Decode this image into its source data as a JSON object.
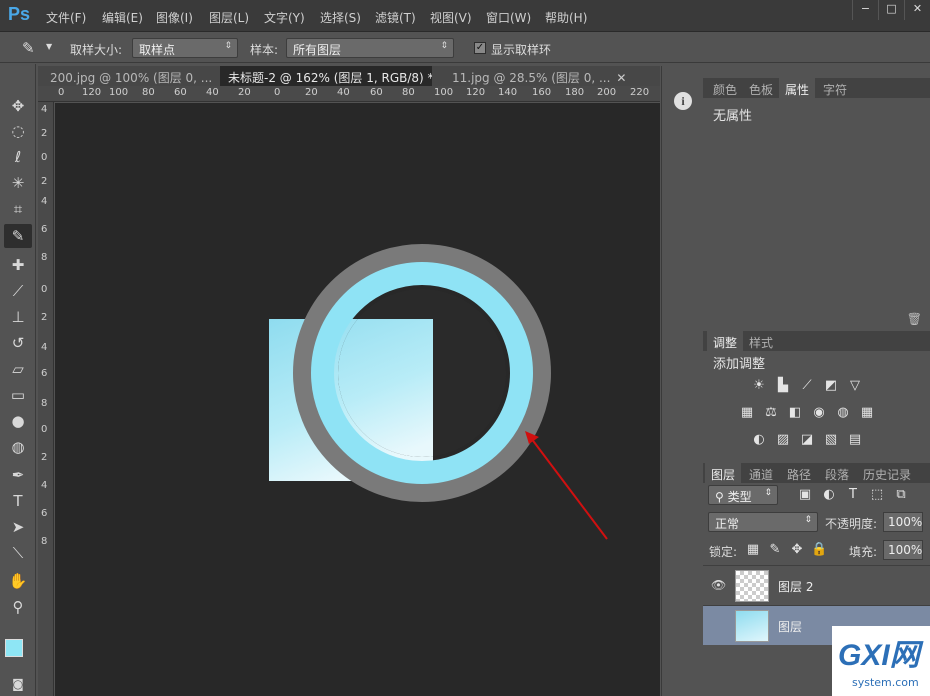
{
  "app": {
    "logo": "Ps"
  },
  "menu": [
    "文件(F)",
    "编辑(E)",
    "图像(I)",
    "图层(L)",
    "文字(Y)",
    "选择(S)",
    "滤镜(T)",
    "视图(V)",
    "窗口(W)",
    "帮助(H)"
  ],
  "window_buttons": [
    "−",
    "□",
    "✕"
  ],
  "options": {
    "sample_size_label": "取样大小:",
    "sample_size_value": "取样点",
    "sample_label": "样本:",
    "sample_value": "所有图层",
    "show_ring_label": "显示取样环",
    "show_ring_checked": "✓"
  },
  "tabs": [
    {
      "label": "200.jpg @ 100% (图层 0, ...",
      "close": "✕"
    },
    {
      "label": "未标题-2 @ 162% (图层 1, RGB/8) *",
      "close": "✕"
    },
    {
      "label": "11.jpg @ 28.5% (图层 0, ...",
      "close": "✕"
    }
  ],
  "ruler_h": [
    "0",
    "120",
    "100",
    "80",
    "60",
    "40",
    "20",
    "0",
    "20",
    "40",
    "60",
    "80",
    "100",
    "120",
    "140",
    "160",
    "180",
    "200",
    "220"
  ],
  "ruler_v": [
    "4",
    "2",
    "0",
    "2",
    "4",
    "6",
    "8",
    "0",
    "2",
    "4",
    "6",
    "8",
    "0",
    "2",
    "4",
    "6",
    "8"
  ],
  "properties": {
    "tabs": [
      "颜色",
      "色板",
      "属性",
      "字符"
    ],
    "content": "无属性"
  },
  "adjustments": {
    "tabs": [
      "调整",
      "样式"
    ],
    "title": "添加调整",
    "icons": [
      "brightness-icon",
      "levels-icon",
      "curves-icon",
      "exposure-icon",
      "vibrance-icon",
      "hue-icon",
      "balance-icon",
      "bw-icon",
      "photo-filter-icon",
      "mixer-icon",
      "lookup-icon",
      "invert-icon",
      "posterize-icon",
      "threshold-icon",
      "selective-color-icon",
      "gradient-map-icon"
    ],
    "glyphs": [
      "☀",
      "▙",
      "⟋",
      "◩",
      "▽",
      "▦",
      "⚖",
      "◧",
      "◉",
      "◍",
      "▦",
      "◐",
      "▨",
      "◪",
      "▧",
      "▤"
    ]
  },
  "layers": {
    "tabs": [
      "图层",
      "通道",
      "路径",
      "段落",
      "历史记录"
    ],
    "filter": "类型",
    "blend": "正常",
    "opacity_label": "不透明度:",
    "opacity_value": "100%",
    "lock_label": "锁定:",
    "fill_label": "填充:",
    "fill_value": "100%",
    "items": [
      {
        "name": "图层 2"
      },
      {
        "name": "图层"
      }
    ]
  },
  "watermark": {
    "text": "GXI网",
    "sub": "system.com"
  }
}
